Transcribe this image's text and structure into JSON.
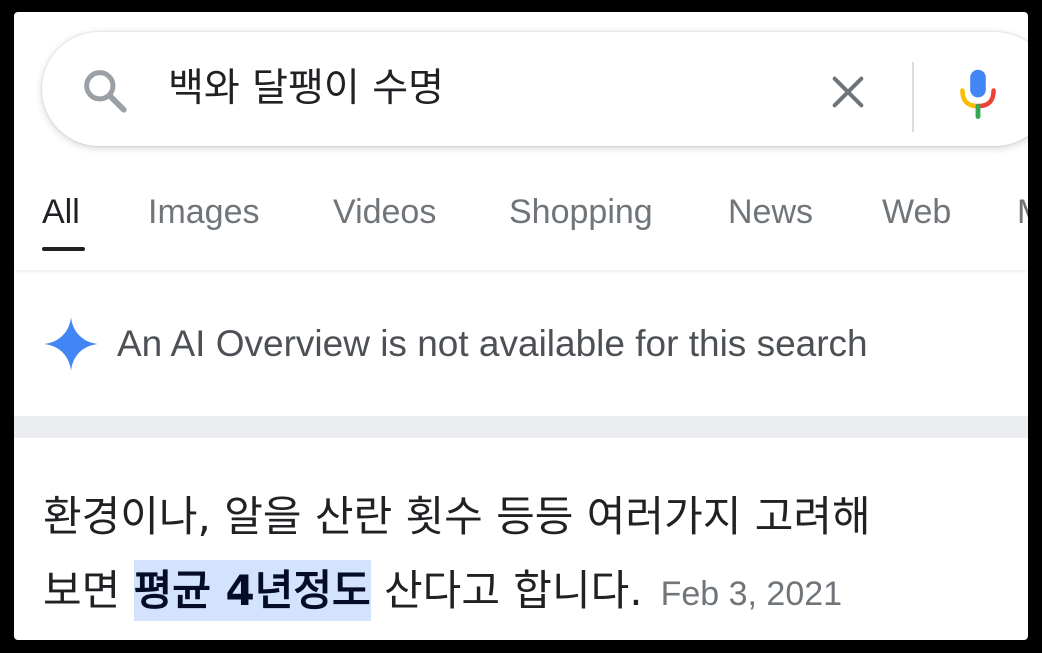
{
  "search": {
    "query": "백와 달팽이 수명"
  },
  "tabs": [
    {
      "label": "All",
      "active": true
    },
    {
      "label": "Images",
      "active": false
    },
    {
      "label": "Videos",
      "active": false
    },
    {
      "label": "Shopping",
      "active": false
    },
    {
      "label": "News",
      "active": false
    },
    {
      "label": "Web",
      "active": false
    },
    {
      "label": "M",
      "active": false
    }
  ],
  "ai_overview": {
    "message": "An AI Overview is not available for this search"
  },
  "snippet": {
    "line1": "환경이나, 알을 산란 횟수 등등 여러가지 고려해",
    "line2_prefix": "보면 ",
    "highlight": "평균 4년정도",
    "line2_suffix": " 산다고 합니다.",
    "date": "Feb 3, 2021"
  },
  "colors": {
    "accent_blue": "#4285f4",
    "highlight_bg": "#d3e3fd",
    "muted_text": "#70757a"
  }
}
